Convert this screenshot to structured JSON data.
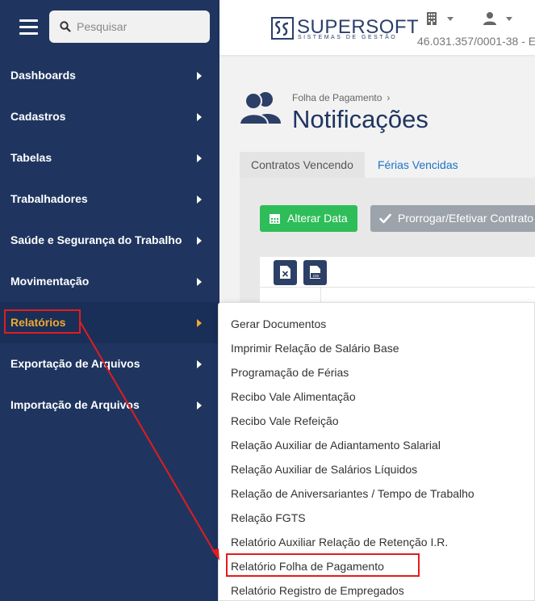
{
  "search": {
    "placeholder": "Pesquisar"
  },
  "sidebar": {
    "items": [
      {
        "label": "Dashboards"
      },
      {
        "label": "Cadastros"
      },
      {
        "label": "Tabelas"
      },
      {
        "label": "Trabalhadores"
      },
      {
        "label": "Saúde e Segurança do Trabalho"
      },
      {
        "label": "Movimentação"
      },
      {
        "label": "Relatórios",
        "active": true
      },
      {
        "label": "Exportação de Arquivos"
      },
      {
        "label": "Importação de Arquivos"
      }
    ]
  },
  "header": {
    "brand_name": "SUPERSOFT",
    "brand_subtitle": "SISTEMAS DE GESTÃO",
    "cnpj": "46.031.357/0001-38 - E"
  },
  "page": {
    "breadcrumb": "Folha de Pagamento",
    "breadcrumb_separator": "›",
    "title": "Notificações"
  },
  "tabs": [
    {
      "label": "Contratos Vencendo",
      "active": true
    },
    {
      "label": "Férias Vencidas",
      "active": false
    }
  ],
  "actions": {
    "alterar_data": "Alterar Data",
    "prorrogar": "Prorrogar/Efetivar Contrato"
  },
  "export": {
    "excel_icon": "excel-file-icon",
    "csv_icon": "csv-file-icon"
  },
  "reports_menu": {
    "items": [
      {
        "label": "Gerar Documentos"
      },
      {
        "label": "Imprimir Relação de Salário Base"
      },
      {
        "label": "Programação de Férias"
      },
      {
        "label": "Recibo Vale Alimentação"
      },
      {
        "label": "Recibo Vale Refeição"
      },
      {
        "label": "Relação Auxiliar de Adiantamento Salarial"
      },
      {
        "label": "Relação Auxiliar de Salários Líquidos"
      },
      {
        "label": "Relação de Aniversariantes / Tempo de Trabalho"
      },
      {
        "label": "Relação FGTS"
      },
      {
        "label": "Relatório Auxiliar Relação de Retenção I.R."
      },
      {
        "label": "Relatório Folha de Pagamento",
        "highlighted": true
      },
      {
        "label": "Relatório Registro de Empregados"
      }
    ]
  },
  "colors": {
    "sidebar_bg": "#1f3560",
    "active_menu_text": "#f0a830",
    "annotation_red": "#e31c1c",
    "green_button": "#2ebd59",
    "gray_button": "#9ca3aa",
    "link_blue": "#1a73c8"
  }
}
